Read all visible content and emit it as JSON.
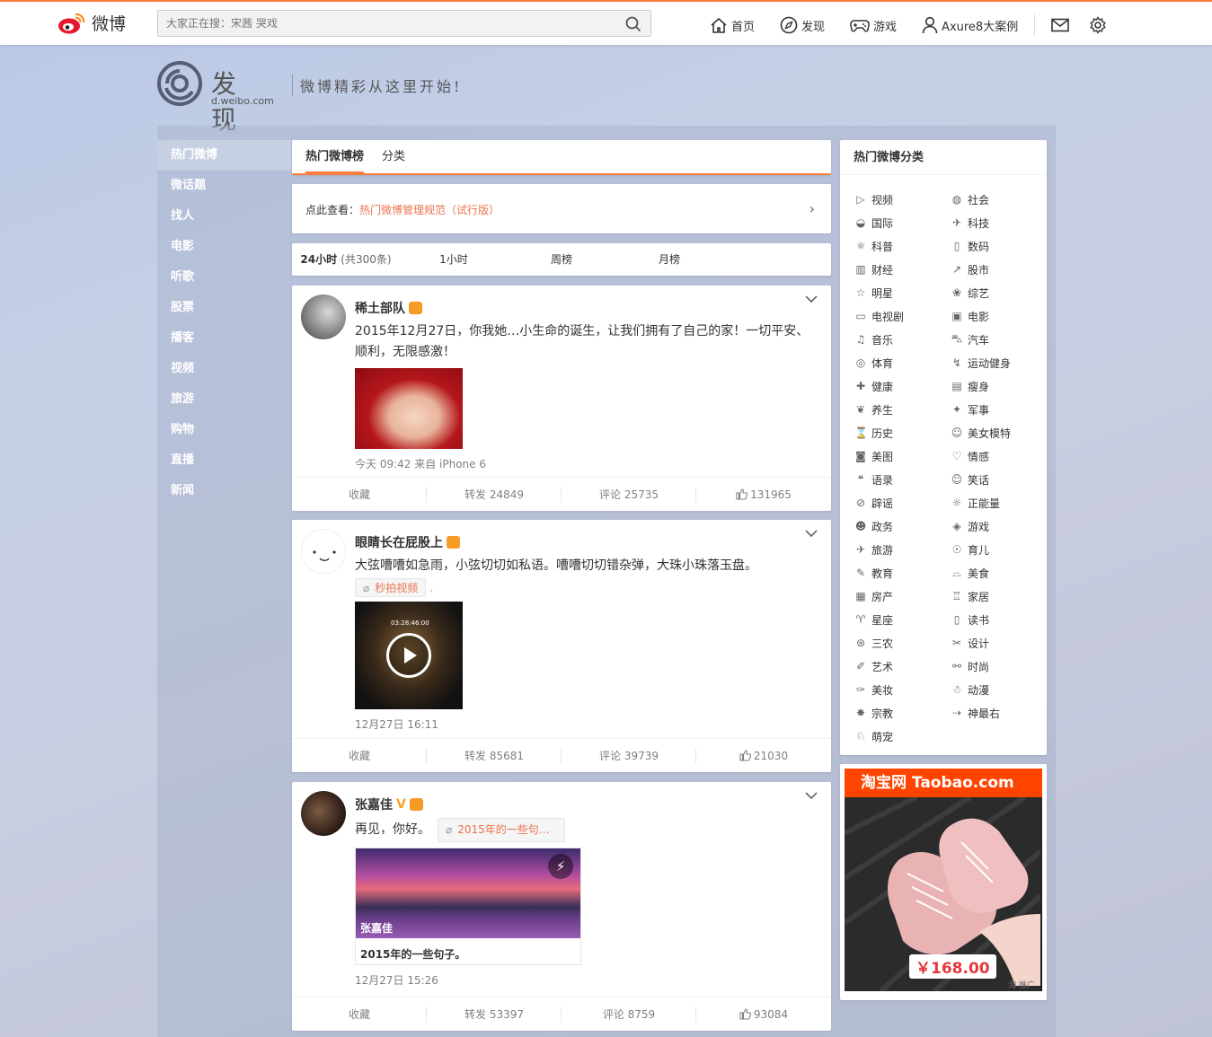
{
  "topbar": {
    "logo_text": "微博",
    "search_placeholder": "大家正在搜：宋茜 哭戏",
    "nav": [
      {
        "label": "首页",
        "icon": "home-icon"
      },
      {
        "label": "发现",
        "icon": "compass-icon"
      },
      {
        "label": "游戏",
        "icon": "gamepad-icon"
      },
      {
        "label": "Axure8大案例",
        "icon": "user-icon"
      }
    ],
    "accent_color": "#fa7d3c"
  },
  "header": {
    "title": "发现",
    "url": "d.weibo.com",
    "slogan": "微博精彩从这里开始!"
  },
  "sidebar": {
    "items": [
      "热门微博",
      "微话题",
      "找人",
      "电影",
      "听歌",
      "股票",
      "播客",
      "视频",
      "旅游",
      "购物",
      "直播",
      "新闻"
    ],
    "active_index": 0
  },
  "tabs": [
    "热门微博榜",
    "分类"
  ],
  "notice": {
    "prefix": "点此查看：",
    "link": "热门微博管理规范（试行版）"
  },
  "ranges": {
    "items": [
      "24小时",
      "1小时",
      "周榜",
      "月榜"
    ],
    "count_note": "(共300条)"
  },
  "posts": [
    {
      "name": "稀土部队",
      "text": "2015年12月27日，你我她…小生命的诞生，让我们拥有了自己的家！一切平安、顺利，无限感激！",
      "time": "今天 09:42 来自 iPhone 6",
      "collect": "收藏",
      "repost": "转发 24849",
      "comment": "评论 25735",
      "like": "131965"
    },
    {
      "name": "眼睛长在屁股上",
      "text": "大弦嘈嘈如急雨，小弦切切如私语。嘈嘈切切错杂弹，大珠小珠落玉盘。",
      "tag": "秒拍视频",
      "video_timestamp": "03:28:46:00",
      "time": "12月27日 16:11",
      "collect": "收藏",
      "repost": "转发 85681",
      "comment": "评论 39739",
      "like": "21030"
    },
    {
      "name": "张嘉佳",
      "text": "再见，你好。",
      "tag": "2015年的一些句…",
      "card_caption": "张嘉佳",
      "card_title": "2015年的一些句子。",
      "time": "12月27日 15:26",
      "collect": "收藏",
      "repost": "转发 53397",
      "comment": "评论 8759",
      "like": "93084"
    }
  ],
  "categories": {
    "title": "热门微博分类",
    "items": [
      {
        "label": "视频",
        "icon": "play-icon"
      },
      {
        "label": "社会",
        "icon": "globe-icon"
      },
      {
        "label": "国际",
        "icon": "earth-icon"
      },
      {
        "label": "科技",
        "icon": "rocket-icon"
      },
      {
        "label": "科普",
        "icon": "atom-icon"
      },
      {
        "label": "数码",
        "icon": "device-icon"
      },
      {
        "label": "财经",
        "icon": "bar-icon"
      },
      {
        "label": "股市",
        "icon": "stock-icon"
      },
      {
        "label": "明星",
        "icon": "star-icon"
      },
      {
        "label": "综艺",
        "icon": "variety-icon"
      },
      {
        "label": "电视剧",
        "icon": "tv-icon"
      },
      {
        "label": "电影",
        "icon": "film-icon"
      },
      {
        "label": "音乐",
        "icon": "music-icon"
      },
      {
        "label": "汽车",
        "icon": "car-icon"
      },
      {
        "label": "体育",
        "icon": "ball-icon"
      },
      {
        "label": "运动健身",
        "icon": "fitness-icon"
      },
      {
        "label": "健康",
        "icon": "medkit-icon"
      },
      {
        "label": "瘦身",
        "icon": "scale-icon"
      },
      {
        "label": "养生",
        "icon": "leaf-icon"
      },
      {
        "label": "军事",
        "icon": "military-icon"
      },
      {
        "label": "历史",
        "icon": "history-icon"
      },
      {
        "label": "美女模特",
        "icon": "model-icon"
      },
      {
        "label": "美图",
        "icon": "camera-icon"
      },
      {
        "label": "情感",
        "icon": "heart-cloud-icon"
      },
      {
        "label": "语录",
        "icon": "quote-icon"
      },
      {
        "label": "笑话",
        "icon": "smile-icon"
      },
      {
        "label": "辟谣",
        "icon": "ban-icon"
      },
      {
        "label": "正能量",
        "icon": "sun-icon"
      },
      {
        "label": "政务",
        "icon": "gov-icon"
      },
      {
        "label": "游戏",
        "icon": "gamepad-icon"
      },
      {
        "label": "旅游",
        "icon": "plane-icon"
      },
      {
        "label": "育儿",
        "icon": "baby-icon"
      },
      {
        "label": "教育",
        "icon": "pencil-icon"
      },
      {
        "label": "美食",
        "icon": "dish-icon"
      },
      {
        "label": "房产",
        "icon": "building-icon"
      },
      {
        "label": "家居",
        "icon": "lamp-icon"
      },
      {
        "label": "星座",
        "icon": "zodiac-icon"
      },
      {
        "label": "读书",
        "icon": "book-icon"
      },
      {
        "label": "三农",
        "icon": "farm-icon"
      },
      {
        "label": "设计",
        "icon": "design-icon"
      },
      {
        "label": "艺术",
        "icon": "brush-icon"
      },
      {
        "label": "时尚",
        "icon": "fashion-icon"
      },
      {
        "label": "美妆",
        "icon": "makeup-icon"
      },
      {
        "label": "动漫",
        "icon": "anime-icon"
      },
      {
        "label": "宗教",
        "icon": "religion-icon"
      },
      {
        "label": "神最右",
        "icon": "right-icon"
      },
      {
        "label": "萌宠",
        "icon": "pet-icon"
      }
    ]
  },
  "ad": {
    "banner": "淘宝网 Taobao.com",
    "price": "￥168.00",
    "tag": "淘 推广"
  }
}
